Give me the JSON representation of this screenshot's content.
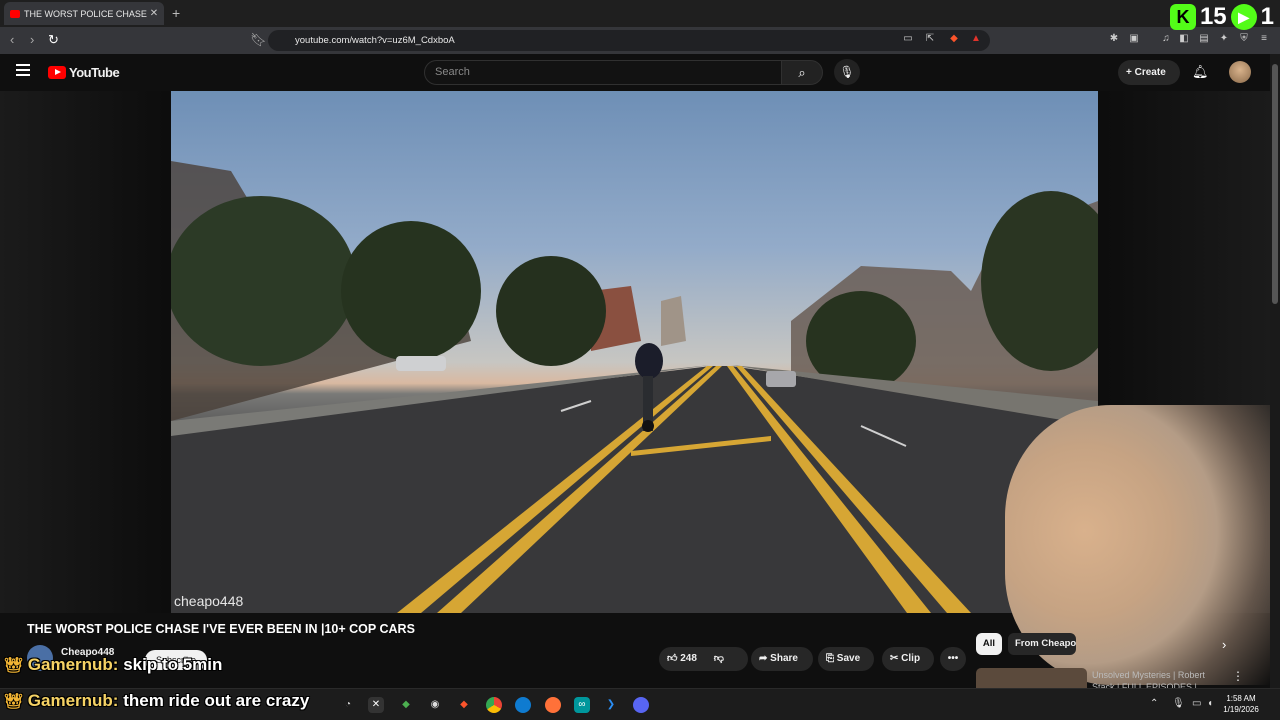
{
  "browser": {
    "tab_title": "THE WORST POLICE CHASE I'",
    "tab_close": "✕",
    "new_tab": "+",
    "url": "youtube.com/watch?v=uz6M_CdxboA"
  },
  "overlay_counter": {
    "viewers": "15",
    "second": "1"
  },
  "youtube": {
    "logo_text": "YouTube",
    "search_placeholder": "Search",
    "create_label": "Create"
  },
  "video": {
    "watermark": "cheapo448",
    "title": "THE WORST POLICE CHASE I'VE EVER BEEN IN |10+ COP CARS",
    "channel": "Cheapo448",
    "subscribe_label": "Subscribe",
    "likes": "248",
    "share_label": "Share",
    "save_label": "Save",
    "clip_label": "Clip",
    "more_label": "•••"
  },
  "recommendations": {
    "chip_all": "All",
    "chip_from": "From Cheapo448",
    "rec_title": "Unsolved Mysteries | Robert Stack | FULL EPISODES |"
  },
  "chat": [
    {
      "user": "Gamernub:",
      "message": "skip to 5min"
    },
    {
      "user": "Gamernub:",
      "message": "them ride out are crazy"
    }
  ],
  "taskbar": {
    "time": "1:58 AM",
    "date": "1/19/2026"
  },
  "colors": {
    "yt_red": "#ff0000",
    "kick_green": "#53fc18",
    "chat_user": "#f6d365"
  }
}
